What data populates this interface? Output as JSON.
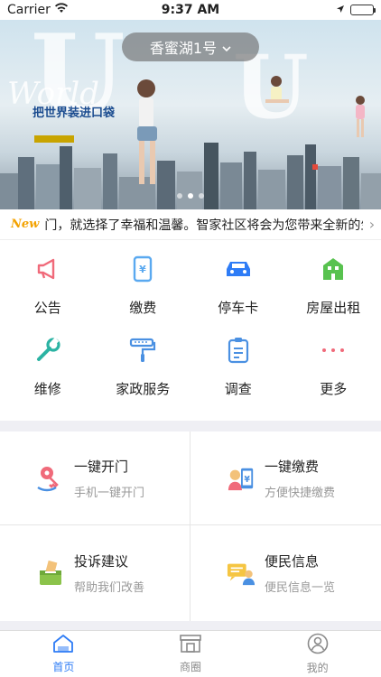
{
  "status": {
    "carrier": "Carrier",
    "time": "9:37 AM"
  },
  "banner": {
    "location": "香蜜湖1号",
    "world_text": "World",
    "promo_text": "把世界装进口袋"
  },
  "notice": {
    "badge": "New",
    "text": "门，就选择了幸福和温馨。智家社区将会为您带来全新的生活体验"
  },
  "services": [
    {
      "label": "公告",
      "icon": "megaphone-icon",
      "color": "#f06a7a"
    },
    {
      "label": "缴费",
      "icon": "phone-payment-icon",
      "color": "#5aa9f0"
    },
    {
      "label": "停车卡",
      "icon": "car-icon",
      "color": "#2e7cf6"
    },
    {
      "label": "房屋出租",
      "icon": "building-icon",
      "color": "#58c24f"
    },
    {
      "label": "维修",
      "icon": "wrench-icon",
      "color": "#2bb3a3"
    },
    {
      "label": "家政服务",
      "icon": "paint-roller-icon",
      "color": "#4a90e2"
    },
    {
      "label": "调查",
      "icon": "clipboard-icon",
      "color": "#4a90e2"
    },
    {
      "label": "更多",
      "icon": "more-dots-icon",
      "color": "#f06a7a"
    }
  ],
  "cards": [
    {
      "title": "一键开门",
      "sub": "手机一键开门",
      "icon": "key-icon"
    },
    {
      "title": "一键缴费",
      "sub": "方便快捷缴费",
      "icon": "mobile-pay-icon"
    },
    {
      "title": "投诉建议",
      "sub": "帮助我们改善",
      "icon": "suggestion-box-icon"
    },
    {
      "title": "便民信息",
      "sub": "便民信息一览",
      "icon": "info-chat-icon"
    }
  ],
  "tabs": [
    {
      "label": "首页",
      "icon": "home-icon",
      "active": true
    },
    {
      "label": "商圈",
      "icon": "store-icon",
      "active": false
    },
    {
      "label": "我的",
      "icon": "profile-icon",
      "active": false
    }
  ],
  "colors": {
    "accent": "#2e7cf6",
    "notice_badge": "#f3a200"
  }
}
